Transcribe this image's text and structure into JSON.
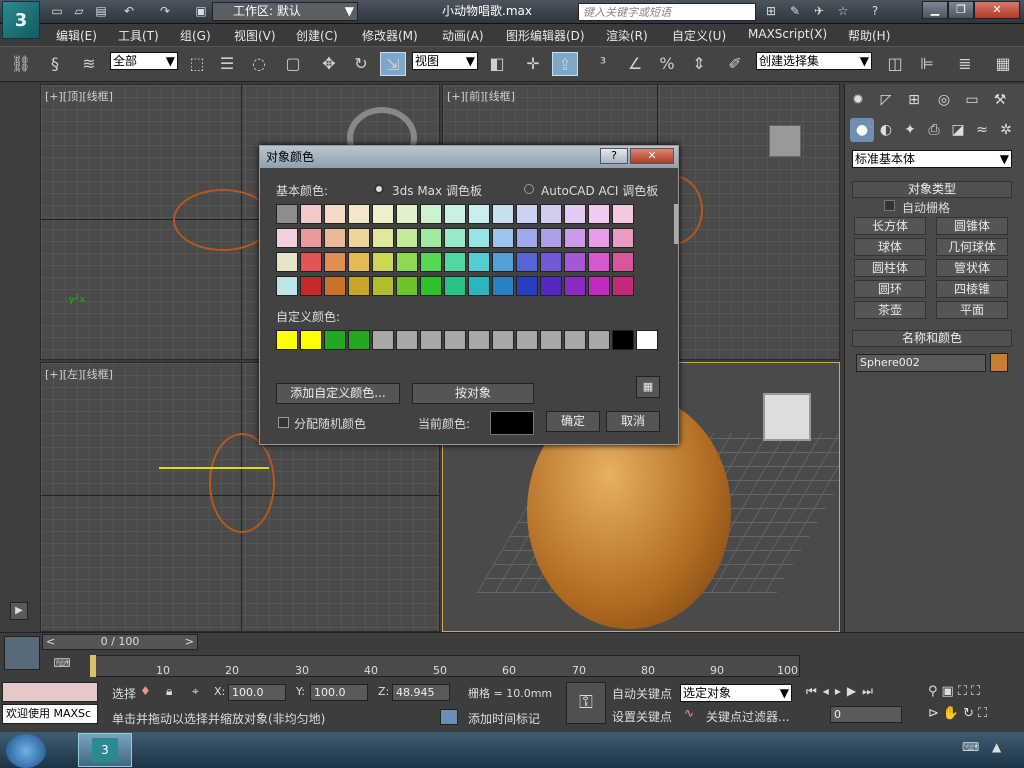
{
  "window": {
    "workspace": "工作区: 默认",
    "document_title": "小动物唱歌.max",
    "search_placeholder": "键入关键字或短语",
    "logo_text": "3"
  },
  "menu": [
    "编辑(E)",
    "工具(T)",
    "组(G)",
    "视图(V)",
    "创建(C)",
    "修改器(M)",
    "动画(A)",
    "图形编辑器(D)",
    "渲染(R)",
    "自定义(U)",
    "MAXScript(X)",
    "帮助(H)"
  ],
  "toolbar": {
    "filter": "全部",
    "ref_coord": "视图",
    "selection_set": "创建选择集"
  },
  "viewports": {
    "top": "[+][顶][线框]",
    "front": "[+][前][线框]",
    "left": "[+][左][线框]",
    "perspective": ""
  },
  "command_panel": {
    "category": "标准基本体",
    "object_type_header": "对象类型",
    "auto_grid": "自动栅格",
    "buttons": [
      "长方体",
      "圆锥体",
      "球体",
      "几何球体",
      "圆柱体",
      "管状体",
      "圆环",
      "四棱锥",
      "茶壶",
      "平面"
    ],
    "name_color_header": "名称和颜色",
    "object_name": "Sphere002",
    "object_color": "#c8802e"
  },
  "dialog": {
    "title": "对象颜色",
    "basic_colors_label": "基本颜色:",
    "radio_max": "3ds Max 调色板",
    "radio_acad": "AutoCAD ACI 调色板",
    "custom_colors_label": "自定义颜色:",
    "add_custom": "添加自定义颜色...",
    "by_object": "按对象",
    "random": "分配随机颜色",
    "current_color_label": "当前颜色:",
    "ok": "确定",
    "cancel": "取消",
    "current_color": "#000000",
    "basic_colors": [
      [
        "#8e8e8e",
        "#f2c9c9",
        "#f3d9c6",
        "#f2e7c7",
        "#eef0c9",
        "#dff2c9",
        "#cdf2cf",
        "#c8f1e1",
        "#c8eef0",
        "#c8dff2",
        "#cbd3f2",
        "#d3cbf2",
        "#e3caf2",
        "#f1caf0",
        "#f2c9de"
      ],
      [
        "#f2cfe0",
        "#ea9a9a",
        "#ecb996",
        "#edd497",
        "#e0e89a",
        "#c2ea98",
        "#9eea9f",
        "#98e9c8",
        "#98e3e6",
        "#99c6ea",
        "#9ea8ea",
        "#ae9eea",
        "#cb9bea",
        "#e89be6",
        "#ea9bc4"
      ],
      [
        "#e6e3c6",
        "#de5656",
        "#e08e52",
        "#e2bc53",
        "#ccd755",
        "#8fd853",
        "#55d858",
        "#52d6a2",
        "#52cdd3",
        "#549fd8",
        "#5666d8",
        "#7358d8",
        "#a557d8",
        "#d657d2",
        "#d8569c"
      ],
      [
        "#bde6e9",
        "#c52929",
        "#c9722a",
        "#c6a52a",
        "#b1bd2b",
        "#6ec22a",
        "#2bc22e",
        "#2ac185",
        "#2ab6bc",
        "#2a80c2",
        "#2a3cc2",
        "#522ac2",
        "#8a2ac2",
        "#c22abd",
        "#c22a78"
      ]
    ],
    "custom_colors": [
      "#ffff00",
      "#ffff00",
      "#22a822",
      "#22a822",
      "#a8a8a8",
      "#a8a8a8",
      "#a8a8a8",
      "#a8a8a8",
      "#a8a8a8",
      "#a8a8a8",
      "#a8a8a8",
      "#a8a8a8",
      "#a8a8a8",
      "#a8a8a8",
      "#000000",
      "#ffffff"
    ]
  },
  "timeline": {
    "frame": "0 / 100",
    "ticks": [
      "10",
      "20",
      "30",
      "40",
      "50",
      "60",
      "70",
      "80",
      "90",
      "100"
    ]
  },
  "status": {
    "welcome": "欢迎使用 MAXSc",
    "select_label": "选择",
    "x_label": "X:",
    "x": "100.0",
    "y_label": "Y:",
    "y": "100.0",
    "z_label": "Z:",
    "z": "48.945",
    "grid": "栅格 = 10.0mm",
    "prompt": "单击并拖动以选择并缩放对象(非均匀地)",
    "add_time_tag": "添加时间标记",
    "auto_key": "自动关键点",
    "set_key": "设置关键点",
    "key_filter_select": "选定对象",
    "key_filters": "关键点过滤器...",
    "frame_field": "0"
  }
}
